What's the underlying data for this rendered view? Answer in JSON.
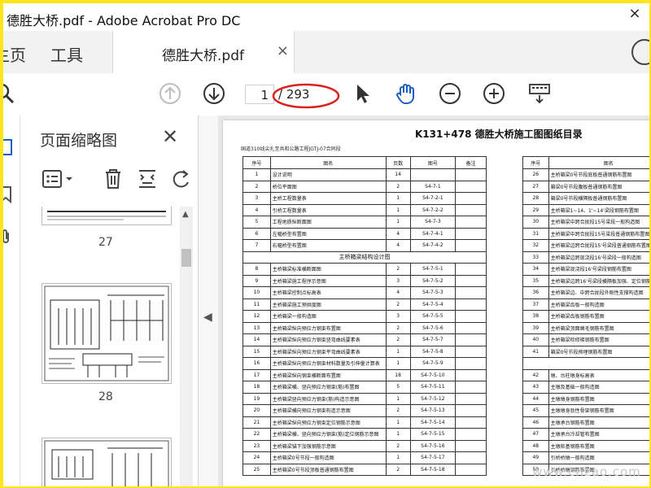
{
  "window": {
    "title": "德胜大桥.pdf - Adobe Acrobat Pro DC",
    "close_glyph": "×"
  },
  "tabs": {
    "home": "主页",
    "tools": "工具",
    "document": "德胜大桥.pdf",
    "close_glyph": "×"
  },
  "toolbar": {
    "page_current": "1",
    "page_total": "/ 293",
    "icons": [
      "search-icon",
      "prev-page-icon",
      "next-page-icon",
      "select-cursor-icon",
      "hand-tool-icon",
      "zoom-out-icon",
      "zoom-in-icon",
      "keyboard-icon"
    ]
  },
  "panel": {
    "title": "页面缩略图",
    "close_glyph": "✕",
    "thumbnails": [
      {
        "label": "27"
      },
      {
        "label": "28"
      },
      {
        "label": ""
      }
    ]
  },
  "document": {
    "title": "K131+478 德胜大桥施工图图纸目录",
    "subtitle": "国道310线尖扎至共和公路工程JGTJ-07合同段",
    "headers": {
      "seq": "序号",
      "name": "图名",
      "pages": "页数",
      "number": "图号",
      "remark": "备注"
    },
    "left_rows": [
      {
        "seq": "1",
        "name": "设计说明",
        "pages": "14",
        "num": ""
      },
      {
        "seq": "2",
        "name": "桥位平面图",
        "pages": "2",
        "num": "S4-7-1"
      },
      {
        "seq": "3",
        "name": "主桥工程数量表",
        "pages": "1",
        "num": "S4-7-2-1"
      },
      {
        "seq": "4",
        "name": "引桥工程数量表",
        "pages": "1",
        "num": "S4-7-2-2"
      },
      {
        "seq": "5",
        "name": "工程地质纵断面图",
        "pages": "1",
        "num": "S4-7-3"
      },
      {
        "seq": "6",
        "name": "左幅桥型布置图",
        "pages": "4",
        "num": "S4-7-4-1"
      },
      {
        "seq": "7",
        "name": "右幅桥型布置图",
        "pages": "4",
        "num": "S4-7-4-2"
      },
      {
        "section": "主桥箱梁结构设计图"
      },
      {
        "seq": "8",
        "name": "主桥箱梁标准横断面图",
        "pages": "2",
        "num": "S4-7-5-1"
      },
      {
        "seq": "9",
        "name": "主桥箱梁施工程序示意图",
        "pages": "3",
        "num": "S4-7-5-2"
      },
      {
        "seq": "10",
        "name": "主桥箱梁控制点标高表",
        "pages": "4",
        "num": "S4-7-5-3"
      },
      {
        "seq": "11",
        "name": "主桥箱梁施工预拱度图",
        "pages": "2",
        "num": "S4-7-5-4"
      },
      {
        "seq": "12",
        "name": "主桥箱梁一般构造图",
        "pages": "3",
        "num": "S4-7-5-5"
      },
      {
        "seq": "13",
        "name": "主桥箱梁纵向预应力钢束布置图",
        "pages": "2",
        "num": "S4-7-5-6"
      },
      {
        "seq": "14",
        "name": "主桥箱梁纵向预应力钢束竖弯曲线要素表",
        "pages": "2",
        "num": "S4-7-5-7"
      },
      {
        "seq": "15",
        "name": "主桥箱梁纵向预应力钢束平弯曲线要素表",
        "pages": "1",
        "num": "S4-7-5-8"
      },
      {
        "seq": "16",
        "name": "主桥箱梁纵向预应力钢束材料数量及引伸量计算表",
        "pages": "1",
        "num": "S4-7-5-9"
      },
      {
        "seq": "17",
        "name": "主桥箱梁纵向钢束横断面布置图",
        "pages": "18",
        "num": "S4-7-5-10"
      },
      {
        "seq": "18",
        "name": "主桥箱梁横、竖向预应力钢束(筋)布置图",
        "pages": "5",
        "num": "S4-7-5-11"
      },
      {
        "seq": "19",
        "name": "主桥箱梁竖向预应力钢束(筋)构造示意图",
        "pages": "1",
        "num": "S4-7-5-12"
      },
      {
        "seq": "20",
        "name": "主桥箱梁横向预应力钢束构造示意图",
        "pages": "2",
        "num": "S4-7-5-13"
      },
      {
        "seq": "21",
        "name": "主桥箱梁纵向预应力钢束定位钢筋示意图",
        "pages": "1",
        "num": "S4-7-5-14"
      },
      {
        "seq": "22",
        "name": "主桥箱梁横、竖向预应力钢束(筋)定位钢筋示意图",
        "pages": "1",
        "num": "S4-7-5-15"
      },
      {
        "seq": "23",
        "name": "主桥箱梁锚下加强钢筋示意图",
        "pages": "2",
        "num": "S4-7-5-16"
      },
      {
        "seq": "24",
        "name": "主桥箱梁0号节段一般构造图",
        "pages": "1",
        "num": "S4-7-5-17"
      },
      {
        "seq": "25",
        "name": "主桥箱梁0号节段顶板普通钢筋布置图",
        "pages": "2",
        "num": "S4-7-5-18"
      }
    ],
    "right_rows": [
      {
        "seq": "26",
        "name": "主桥箱梁0号节段底板普通钢筋布置图"
      },
      {
        "seq": "27",
        "name": "箱梁0号节段腹板普通钢筋布置图"
      },
      {
        "seq": "28",
        "name": "箱梁0号节段横隔板普通钢筋布置图"
      },
      {
        "seq": "29",
        "name": "主桥箱梁1~14、1'~14'梁段钢筋布置图"
      },
      {
        "seq": "30",
        "name": "主桥箱梁中跨合拢段15号梁段一般构造图"
      },
      {
        "seq": "31",
        "name": "主桥箱梁中跨合拢段15号梁段普通钢筋布置图"
      },
      {
        "seq": "32",
        "name": "主桥箱梁边跨合拢段15'号梁段普通钢筋布置图"
      },
      {
        "seq": "33",
        "name": "主桥箱梁边跨现浇段16'号梁段一般构造图"
      },
      {
        "seq": "34",
        "name": "主桥箱梁现浇段16'号梁段钢筋布置图"
      },
      {
        "seq": "35",
        "name": "主桥箱梁边跨16'号梁段横隔板加强、定位钢筋"
      },
      {
        "seq": "36",
        "name": "主桥箱梁边、中跨合拢段外刚性支撑构造图"
      },
      {
        "seq": "37",
        "name": "主桥箱梁齿板一般构造图"
      },
      {
        "seq": "38",
        "name": "主桥箱梁齿板钢筋布置图"
      },
      {
        "seq": "39",
        "name": "主桥箱梁顶面凿毛钢筋布置图"
      },
      {
        "seq": "40",
        "name": "主桥箱梁检修梯钢筋布置图"
      },
      {
        "seq": "41",
        "name": "箱梁0号节段预埋钢筋布置图"
      },
      {
        "section": "下部构"
      },
      {
        "seq": "42",
        "name": "墩、台柱墩身标高表"
      },
      {
        "seq": "43",
        "name": "主墩及基础一般构造图"
      },
      {
        "seq": "44",
        "name": "主墩墩身钢筋布置图"
      },
      {
        "seq": "45",
        "name": "主墩墩身劲性骨架钢筋布置图"
      },
      {
        "seq": "46",
        "name": "主墩承台钢筋布置图"
      },
      {
        "seq": "47",
        "name": "主墩承台冷却管布置图"
      },
      {
        "seq": "48",
        "name": "主墩桩基钢筋布置图"
      },
      {
        "seq": "49",
        "name": "引桥桥墩一般构造图"
      },
      {
        "seq": "50",
        "name": "引桥桥墩钢筋布置图"
      }
    ]
  },
  "watermark": "www.cnzao.com"
}
